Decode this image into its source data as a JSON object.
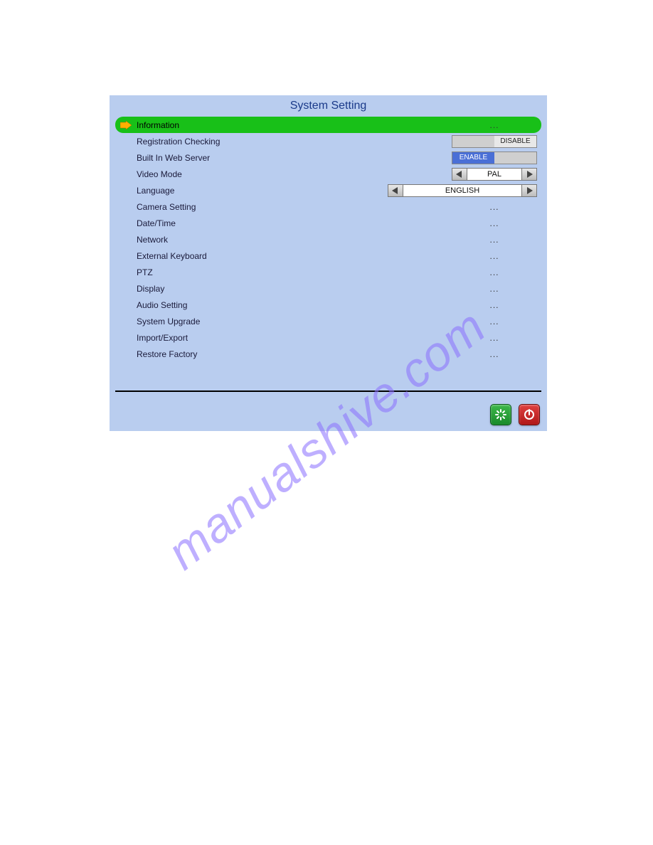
{
  "title": "System Setting",
  "watermark": "manualshive.com",
  "rows": [
    {
      "label": "Information",
      "type": "dots",
      "value": "...",
      "selected": true
    },
    {
      "label": "Registration Checking",
      "type": "toggle-right",
      "value": "DISABLE"
    },
    {
      "label": "Built In Web Server",
      "type": "toggle-left",
      "value": "ENABLE"
    },
    {
      "label": "Video Mode",
      "type": "spinner",
      "value": "PAL"
    },
    {
      "label": "Language",
      "type": "spinner-wide",
      "value": "ENGLISH"
    },
    {
      "label": "Camera Setting",
      "type": "dots",
      "value": "..."
    },
    {
      "label": "Date/Time",
      "type": "dots",
      "value": "..."
    },
    {
      "label": "Network",
      "type": "dots",
      "value": "..."
    },
    {
      "label": "External Keyboard",
      "type": "dots",
      "value": "..."
    },
    {
      "label": "PTZ",
      "type": "dots",
      "value": "..."
    },
    {
      "label": "Display",
      "type": "dots",
      "value": "..."
    },
    {
      "label": "Audio Setting",
      "type": "dots",
      "value": "..."
    },
    {
      "label": "System Upgrade",
      "type": "dots",
      "value": "..."
    },
    {
      "label": "Import/Export",
      "type": "dots",
      "value": "..."
    },
    {
      "label": "Restore Factory",
      "type": "dots",
      "value": "..."
    }
  ],
  "footer": {
    "refresh_icon": "refresh",
    "power_icon": "power"
  }
}
